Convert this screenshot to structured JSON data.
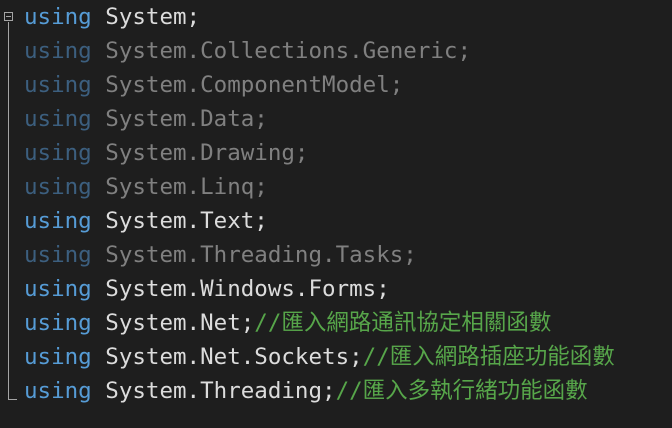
{
  "lines": [
    {
      "keyword": "using",
      "namespace": "System;",
      "comment": "",
      "faded": false
    },
    {
      "keyword": "using",
      "namespace": "System.Collections.Generic;",
      "comment": "",
      "faded": true
    },
    {
      "keyword": "using",
      "namespace": "System.ComponentModel;",
      "comment": "",
      "faded": true
    },
    {
      "keyword": "using",
      "namespace": "System.Data;",
      "comment": "",
      "faded": true
    },
    {
      "keyword": "using",
      "namespace": "System.Drawing;",
      "comment": "",
      "faded": true
    },
    {
      "keyword": "using",
      "namespace": "System.Linq;",
      "comment": "",
      "faded": true
    },
    {
      "keyword": "using",
      "namespace": "System.Text;",
      "comment": "",
      "faded": false
    },
    {
      "keyword": "using",
      "namespace": "System.Threading.Tasks;",
      "comment": "",
      "faded": true
    },
    {
      "keyword": "using",
      "namespace": "System.Windows.Forms;",
      "comment": "",
      "faded": false
    },
    {
      "keyword": "using",
      "namespace": "System.Net;",
      "comment": "//匯入網路通訊協定相關函數",
      "faded": false
    },
    {
      "keyword": "using",
      "namespace": "System.Net.Sockets;",
      "comment": "//匯入網路插座功能函數",
      "faded": false
    },
    {
      "keyword": "using",
      "namespace": "System.Threading;",
      "comment": "//匯入多執行緒功能函數",
      "faded": false
    }
  ],
  "colors": {
    "background": "#1e1e1e",
    "keyword": "#569cd6",
    "keyword_faded": "#3c5f7f",
    "text": "#dcdcdc",
    "text_faded": "#808080",
    "comment": "#57a64a"
  }
}
